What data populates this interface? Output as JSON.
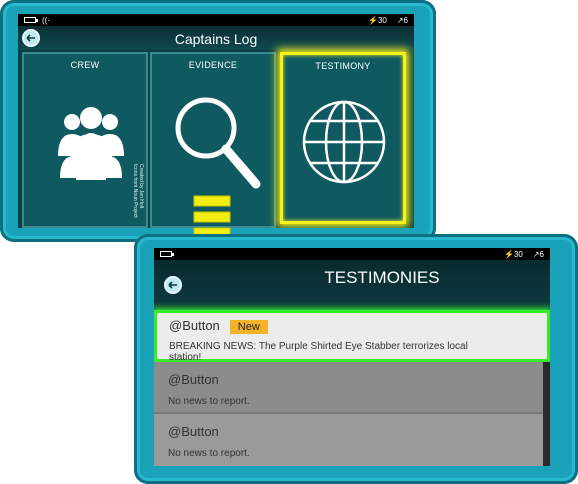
{
  "top_device": {
    "status": {
      "battery": "",
      "signal_icon": "wifi-icon",
      "charge": "30",
      "sig": "6"
    },
    "title": "Captains Log",
    "tiles": [
      {
        "label": "CREW",
        "icon": "crew-icon"
      },
      {
        "label": "EVIDENCE",
        "icon": "magnifier-icon"
      },
      {
        "label": "TESTIMONY",
        "icon": "globe-icon",
        "selected": true
      }
    ],
    "credit": "Created by Jen Holt\nIcons from Noun Project"
  },
  "bottom_device": {
    "status": {
      "charge": "30",
      "sig": "6"
    },
    "title": "TESTIMONIES",
    "rows": [
      {
        "title": "@Button",
        "badge": "New",
        "text": "BREAKING NEWS: The Purple Shirted Eye Stabber terrorizes local station!"
      },
      {
        "title": "@Button",
        "text": "No news to report."
      },
      {
        "title": "@Button",
        "text": "No news to report."
      }
    ]
  },
  "colors": {
    "frame": "#1aa3b8",
    "screen": "#0c3d44",
    "selected_tile": "#f4f21a",
    "active_row": "#39ea2a",
    "badge": "#f5b32a",
    "arrow": "#f2ee14"
  }
}
